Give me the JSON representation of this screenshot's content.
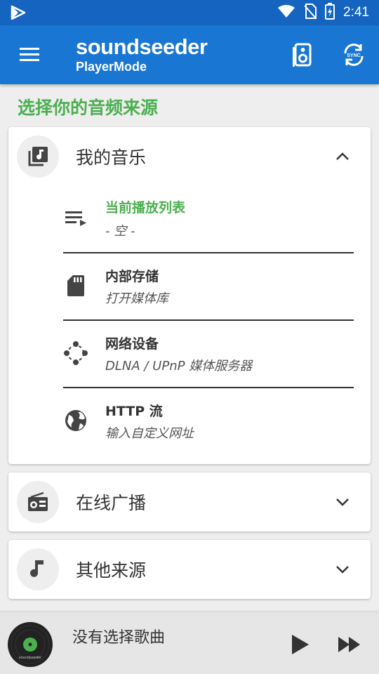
{
  "status_bar": {
    "time": "2:41"
  },
  "app_bar": {
    "brand": "soundseeder",
    "mode": "PlayerMode",
    "sync_label": "SYNC"
  },
  "section_title": "选择你的音频来源",
  "my_music": {
    "title": "我的音乐",
    "items": [
      {
        "title": "当前播放列表",
        "desc": "- 空 -"
      },
      {
        "title": "内部存储",
        "desc": "打开媒体库"
      },
      {
        "title": "网络设备",
        "desc": "DLNA / UPnP 媒体服务器"
      },
      {
        "title": "HTTP 流",
        "desc": "输入自定义网址"
      }
    ]
  },
  "online_radio": {
    "title": "在线广播"
  },
  "other_sources": {
    "title": "其他来源"
  },
  "player": {
    "song": "没有选择歌曲",
    "disc_label": "soundseeder"
  },
  "colors": {
    "primary": "#1976d2",
    "status_bar": "#1565c0",
    "accent_green": "#4caf50"
  }
}
